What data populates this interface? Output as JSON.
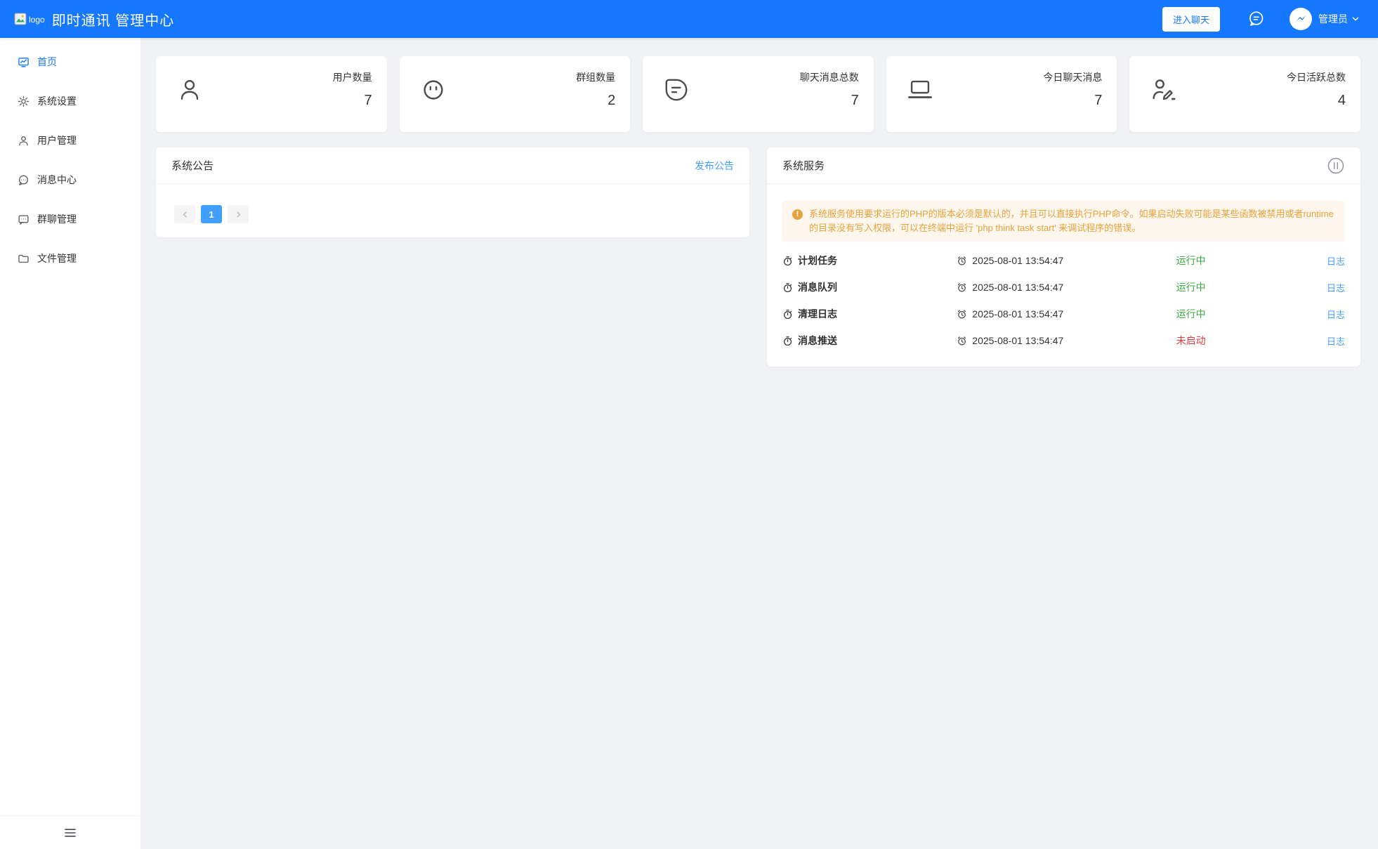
{
  "header": {
    "logo_alt": "logo",
    "title": "即时通讯 管理中心",
    "enter_chat": "进入聊天",
    "admin": "管理员"
  },
  "sidebar": {
    "items": [
      {
        "label": "首页",
        "icon": "dashboard-icon",
        "active": true
      },
      {
        "label": "系统设置",
        "icon": "gear-icon",
        "active": false
      },
      {
        "label": "用户管理",
        "icon": "user-icon",
        "active": false
      },
      {
        "label": "消息中心",
        "icon": "message-round-icon",
        "active": false
      },
      {
        "label": "群聊管理",
        "icon": "message-square-icon",
        "active": false
      },
      {
        "label": "文件管理",
        "icon": "folder-icon",
        "active": false
      }
    ],
    "collapse_icon": "menu-collapse-icon"
  },
  "stats": [
    {
      "label": "用户数量",
      "value": "7",
      "icon": "user-icon"
    },
    {
      "label": "群组数量",
      "value": "2",
      "icon": "face-icon"
    },
    {
      "label": "聊天消息总数",
      "value": "7",
      "icon": "chat-drop-icon"
    },
    {
      "label": "今日聊天消息",
      "value": "7",
      "icon": "laptop-icon"
    },
    {
      "label": "今日活跃总数",
      "value": "4",
      "icon": "active-user-icon"
    }
  ],
  "announcement": {
    "title": "系统公告",
    "publish_label": "发布公告",
    "pagination": {
      "current_page": "1"
    }
  },
  "services": {
    "title": "系统服务",
    "pause_icon": "pause-circle-icon",
    "warning": "系统服务使用要求运行的PHP的版本必须是默认的，并且可以直接执行PHP命令。如果启动失败可能是某些函数被禁用或者runtime的目录没有写入权限，可以在终端中运行 'php think task start' 来调试程序的错误。",
    "rows": [
      {
        "name": "计划任务",
        "time": "2025-08-01 13:54:47",
        "status": "运行中",
        "status_type": "running",
        "log_label": "日志"
      },
      {
        "name": "消息队列",
        "time": "2025-08-01 13:54:47",
        "status": "运行中",
        "status_type": "running",
        "log_label": "日志"
      },
      {
        "name": "清理日志",
        "time": "2025-08-01 13:54:47",
        "status": "运行中",
        "status_type": "running",
        "log_label": "日志"
      },
      {
        "name": "消息推送",
        "time": "2025-08-01 13:54:47",
        "status": "未启动",
        "status_type": "stopped",
        "log_label": "日志"
      }
    ]
  },
  "colors": {
    "header_blue": "#1677ff",
    "link_blue": "#409eff",
    "warning_bg": "#fdf6ec",
    "warning_text": "#e6a23c",
    "status_running": "#3da742",
    "status_stopped": "#e13c3c",
    "page_bg": "#f0f2f5"
  }
}
